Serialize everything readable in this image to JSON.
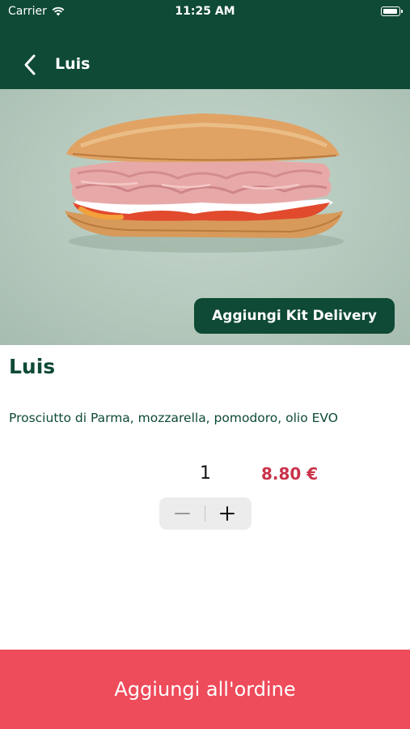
{
  "status_bar": {
    "carrier": "Carrier",
    "time": "11:25 AM"
  },
  "nav": {
    "title": "Luis",
    "back_icon": "chevron-left-icon"
  },
  "hero": {
    "image_subject": "sandwich",
    "kit_button_label": "Aggiungi Kit Delivery"
  },
  "product": {
    "name": "Luis",
    "description": "Prosciutto di Parma, mozzarella, pomodoro, olio EVO",
    "quantity": "1",
    "price": "8.80 €"
  },
  "stepper": {
    "minus_icon": "minus-icon",
    "plus_icon": "plus-icon"
  },
  "footer": {
    "add_button_label": "Aggiungi all'ordine"
  },
  "colors": {
    "brand_green": "#0e4a35",
    "accent_red": "#ee4b5b",
    "price_red": "#c8334a"
  }
}
